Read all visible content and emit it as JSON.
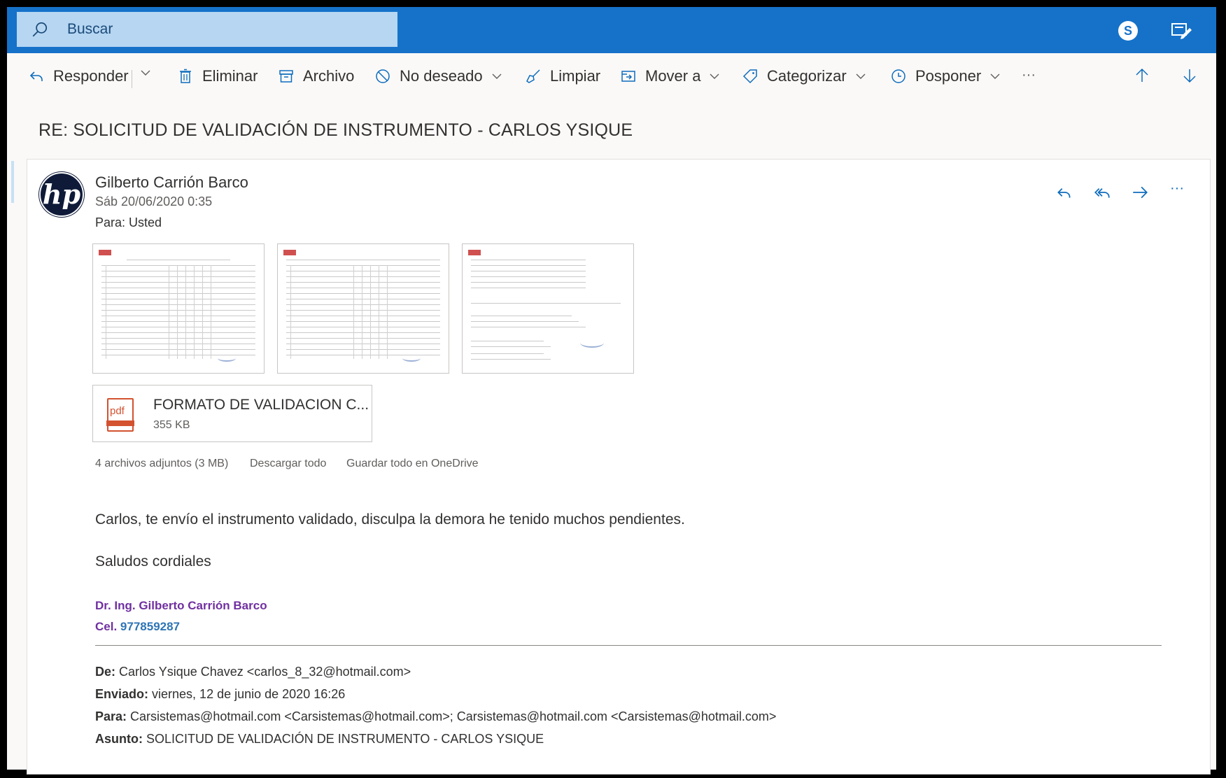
{
  "search": {
    "placeholder": "Buscar"
  },
  "topbar": {
    "skype_icon": "skype-icon",
    "compose_icon": "compose-icon"
  },
  "toolbar": {
    "reply": "Responder",
    "delete": "Eliminar",
    "archive": "Archivo",
    "junk": "No deseado",
    "sweep": "Limpiar",
    "move": "Mover a",
    "categorize": "Categorizar",
    "snooze": "Posponer",
    "more": "···"
  },
  "message": {
    "subject": "RE: SOLICITUD DE VALIDACIÓN DE INSTRUMENTO - CARLOS YSIQUE",
    "avatar_text": "hp",
    "sender": "Gilberto Carrión Barco",
    "date": "Sáb 20/06/2020 0:35",
    "to_label": "Para:",
    "to_value": "Usted",
    "actions_more": "···"
  },
  "attachments": {
    "pdf_badge": "pdf",
    "pdf_name": "FORMATO DE VALIDACION C...",
    "pdf_size": "355 KB",
    "count_label": "4 archivos adjuntos (3 MB)",
    "download_all": "Descargar todo",
    "save_onedrive": "Guardar todo en OneDrive"
  },
  "body": {
    "line1": "Carlos, te envío el instrumento validado, disculpa la demora he tenido muchos pendientes.",
    "line2": "Saludos cordiales",
    "signature_name": "Dr. Ing. Gilberto Carrión Barco",
    "signature_cel_label": "Cel.",
    "signature_cel": "977859287"
  },
  "forwarded": {
    "from_label": "De:",
    "from": "Carlos Ysique Chavez <carlos_8_32@hotmail.com>",
    "sent_label": "Enviado:",
    "sent": "viernes, 12 de junio de 2020 16:26",
    "to_label": "Para:",
    "to": "Carsistemas@hotmail.com <Carsistemas@hotmail.com>; Carsistemas@hotmail.com <Carsistemas@hotmail.com>",
    "subject_label": "Asunto:",
    "subject": "SOLICITUD DE VALIDACIÓN DE INSTRUMENTO - CARLOS YSIQUE"
  },
  "colors": {
    "topbar": "#1672c9",
    "search_bg": "#b6d6f2",
    "signature_purple": "#7030a0",
    "signature_blue": "#2e75b6",
    "pdf_red": "#d35230"
  }
}
